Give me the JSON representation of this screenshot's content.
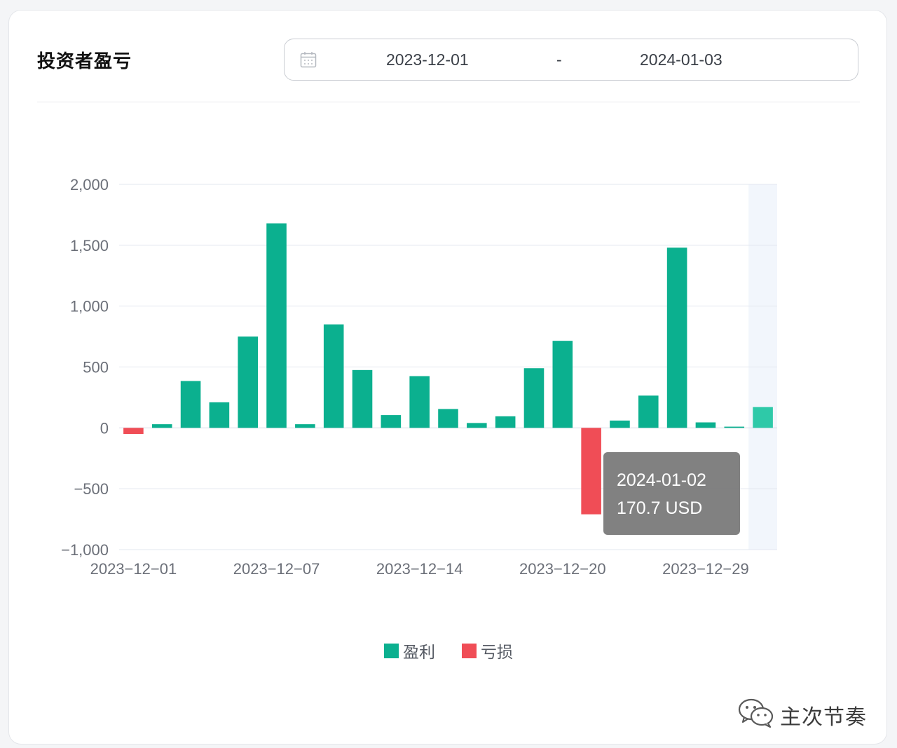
{
  "header": {
    "title": "投资者盈亏"
  },
  "date_range": {
    "start": "2023-12-01",
    "separator": "-",
    "end": "2024-01-03"
  },
  "icons": {
    "calendar": "calendar-icon",
    "wechat": "wechat-icon"
  },
  "colors": {
    "profit": "#0bb08f",
    "loss": "#f04d56",
    "highlight": "#2ec9a8"
  },
  "tooltip": {
    "date": "2024-01-02",
    "value": "170.7 USD"
  },
  "legend": {
    "items": [
      "盈利",
      "亏损"
    ]
  },
  "watermark": {
    "text": "主次节奏"
  },
  "chart_data": {
    "type": "bar",
    "title": "",
    "xlabel": "",
    "ylabel": "",
    "ylim": [
      -1000,
      2000
    ],
    "yticks": [
      2000,
      1500,
      1000,
      500,
      0,
      -500,
      -1000
    ],
    "ytick_labels": [
      "2,000",
      "1,500",
      "1,000",
      "500",
      "0",
      "−500",
      "−1,000"
    ],
    "xtick_labels": [
      {
        "label": "2023−12−01",
        "index": 0
      },
      {
        "label": "2023−12−07",
        "index": 5
      },
      {
        "label": "2023−12−14",
        "index": 10
      },
      {
        "label": "2023−12−20",
        "index": 15
      },
      {
        "label": "2023−12−29",
        "index": 20
      }
    ],
    "values": [
      -50,
      30,
      385,
      210,
      750,
      1680,
      30,
      850,
      475,
      105,
      425,
      155,
      40,
      95,
      490,
      715,
      -710,
      60,
      265,
      1480,
      45,
      10,
      170.7
    ],
    "highlight_index": 22,
    "legend_position": "bottom-center",
    "grid": true
  }
}
